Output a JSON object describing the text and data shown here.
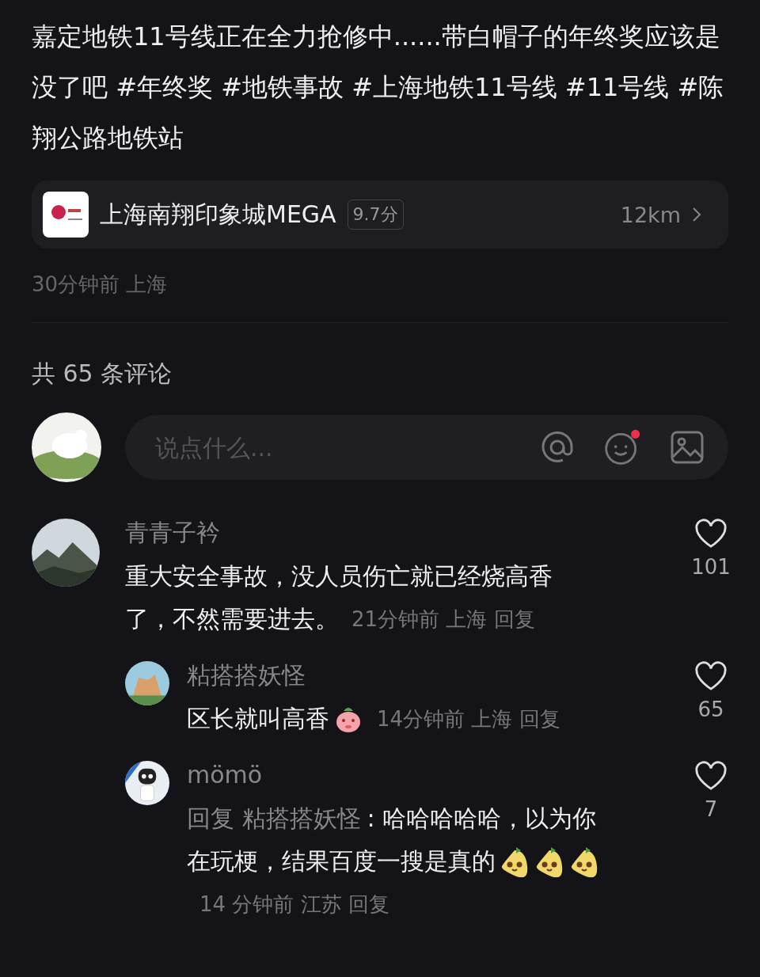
{
  "post": {
    "text": "嘉定地铁11号线正在全力抢修中......带白帽子的年终奖应该是没了吧 #年终奖  #地铁事故  #上海地铁11号线  #11号线 #陈翔公路地铁站",
    "place": {
      "name": "上海南翔印象城MEGA",
      "rating": "9.7分",
      "distance": "12km"
    },
    "meta": "30分钟前 上海"
  },
  "comments_header": "共 65 条评论",
  "input": {
    "placeholder": "说点什么..."
  },
  "comments": [
    {
      "name": "青青子衿",
      "lines": [
        "重大安全事故，没人员伤亡就已经烧高香",
        "了，不然需要进去。"
      ],
      "meta": "21分钟前 上海 回复",
      "likes": "101",
      "replies": [
        {
          "name": "粘搭搭妖怪",
          "lines": [
            "区长就叫高香"
          ],
          "emojis": [
            {
              "kind": "peach"
            }
          ],
          "meta": "14分钟前 上海 回复",
          "likes": "65"
        },
        {
          "name": "mömö",
          "prefix": "回复 粘搭搭妖怪",
          "lines": [
            ": 哈哈哈哈哈，以为你",
            "在玩梗，结果百度一搜是真的"
          ],
          "emojis": [
            {
              "kind": "pear"
            },
            {
              "kind": "pear"
            },
            {
              "kind": "pear"
            }
          ],
          "meta": "14 分钟前 江苏 回复",
          "likes": "7"
        }
      ]
    }
  ]
}
